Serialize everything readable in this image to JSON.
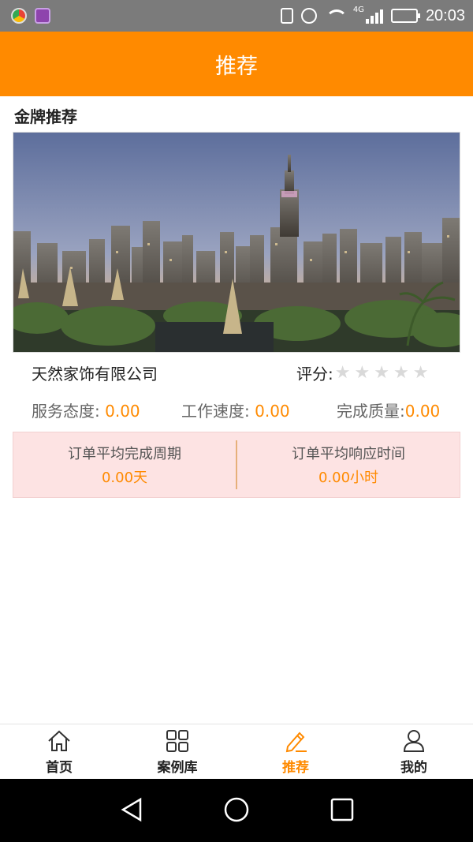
{
  "status_bar": {
    "time": "20:03",
    "network": "4G",
    "battery_fraction": 0.45,
    "icons": [
      "app-icon",
      "gallery-app-icon",
      "vibrate-icon",
      "alarm-icon",
      "wifi-icon",
      "signal-icon",
      "battery-icon"
    ]
  },
  "header": {
    "title": "推荐"
  },
  "section": {
    "title": "金牌推荐"
  },
  "hero_image": {
    "subject": "city-skyline-dusk"
  },
  "company": {
    "name": "天然家饰有限公司",
    "rating_label": "评分:",
    "rating_stars": 0,
    "rating_max": 5
  },
  "metrics": [
    {
      "label": "服务态度:",
      "value": "0.00"
    },
    {
      "label": "工作速度:",
      "value": "0.00"
    },
    {
      "label": "完成质量:",
      "value": "0.00"
    }
  ],
  "stats": [
    {
      "label": "订单平均完成周期",
      "value": "0.00天"
    },
    {
      "label": "订单平均响应时间",
      "value": "0.00小时"
    }
  ],
  "tabbar": {
    "items": [
      {
        "label": "首页",
        "icon": "home-icon",
        "active": false
      },
      {
        "label": "案例库",
        "icon": "grid-icon",
        "active": false
      },
      {
        "label": "推荐",
        "icon": "pencil-icon",
        "active": true
      },
      {
        "label": "我的",
        "icon": "user-icon",
        "active": false
      }
    ]
  },
  "colors": {
    "accent": "#ff8a00",
    "stat_bg": "#fde3e3",
    "star_empty": "#d9d9d9"
  }
}
